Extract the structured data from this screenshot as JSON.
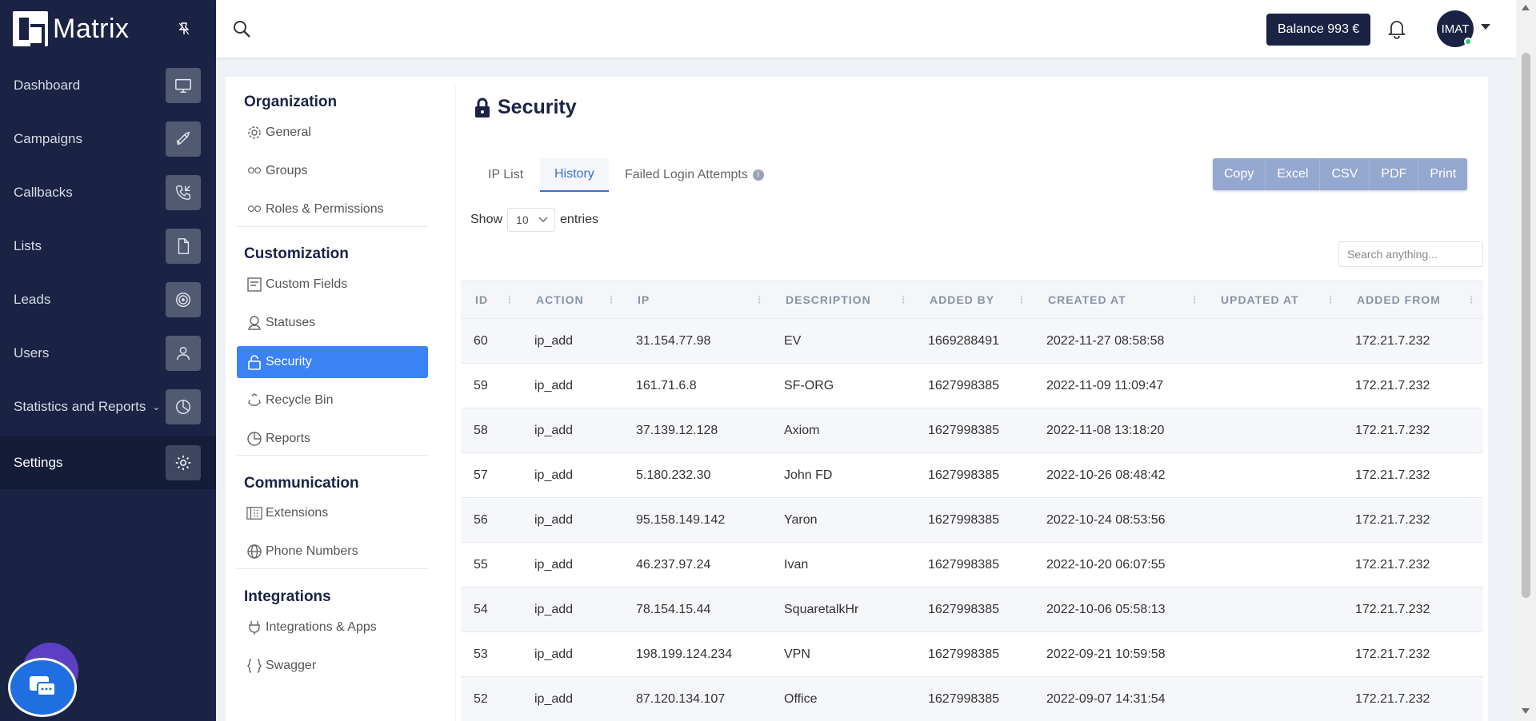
{
  "brand": {
    "name": "Matrix"
  },
  "nav": {
    "items": [
      {
        "label": "Dashboard"
      },
      {
        "label": "Campaigns"
      },
      {
        "label": "Callbacks"
      },
      {
        "label": "Lists"
      },
      {
        "label": "Leads"
      },
      {
        "label": "Users"
      },
      {
        "label": "Statistics and Reports"
      },
      {
        "label": "Settings"
      }
    ]
  },
  "topbar": {
    "balance": "Balance 993 €",
    "user_initials": "IMAT"
  },
  "submenu": {
    "sections": [
      {
        "title": "Organization",
        "items": [
          {
            "label": "General"
          },
          {
            "label": "Groups"
          },
          {
            "label": "Roles & Permissions"
          }
        ]
      },
      {
        "title": "Customization",
        "items": [
          {
            "label": "Custom Fields"
          },
          {
            "label": "Statuses"
          },
          {
            "label": "Security"
          },
          {
            "label": "Recycle Bin"
          },
          {
            "label": "Reports"
          }
        ]
      },
      {
        "title": "Communication",
        "items": [
          {
            "label": "Extensions"
          },
          {
            "label": "Phone Numbers"
          }
        ]
      },
      {
        "title": "Integrations",
        "items": [
          {
            "label": "Integrations & Apps"
          },
          {
            "label": "Swagger"
          }
        ]
      }
    ]
  },
  "page": {
    "title": "Security",
    "tabs": [
      {
        "label": "IP List"
      },
      {
        "label": "History"
      },
      {
        "label": "Failed Login Attempts"
      }
    ],
    "export_buttons": [
      {
        "label": "Copy"
      },
      {
        "label": "Excel"
      },
      {
        "label": "CSV"
      },
      {
        "label": "PDF"
      },
      {
        "label": "Print"
      }
    ],
    "show_label": "Show",
    "entries_value": "10",
    "entries_label": "entries",
    "search_placeholder": "Search anything..."
  },
  "table": {
    "columns": [
      "ID",
      "ACTION",
      "IP",
      "DESCRIPTION",
      "ADDED BY",
      "CREATED AT",
      "UPDATED AT",
      "ADDED FROM"
    ],
    "rows": [
      [
        "60",
        "ip_add",
        "31.154.77.98",
        "EV",
        "1669288491",
        "2022-11-27 08:58:58",
        "",
        "172.21.7.232"
      ],
      [
        "59",
        "ip_add",
        "161.71.6.8",
        "SF-ORG",
        "1627998385",
        "2022-11-09 11:09:47",
        "",
        "172.21.7.232"
      ],
      [
        "58",
        "ip_add",
        "37.139.12.128",
        "Axiom",
        "1627998385",
        "2022-11-08 13:18:20",
        "",
        "172.21.7.232"
      ],
      [
        "57",
        "ip_add",
        "5.180.232.30",
        "John FD",
        "1627998385",
        "2022-10-26 08:48:42",
        "",
        "172.21.7.232"
      ],
      [
        "56",
        "ip_add",
        "95.158.149.142",
        "Yaron",
        "1627998385",
        "2022-10-24 08:53:56",
        "",
        "172.21.7.232"
      ],
      [
        "55",
        "ip_add",
        "46.237.97.24",
        "Ivan",
        "1627998385",
        "2022-10-20 06:07:55",
        "",
        "172.21.7.232"
      ],
      [
        "54",
        "ip_add",
        "78.154.15.44",
        "SquaretalkHr",
        "1627998385",
        "2022-10-06 05:58:13",
        "",
        "172.21.7.232"
      ],
      [
        "53",
        "ip_add",
        "198.199.124.234",
        "VPN",
        "1627998385",
        "2022-09-21 10:59:58",
        "",
        "172.21.7.232"
      ],
      [
        "52",
        "ip_add",
        "87.120.134.107",
        "Office",
        "1627998385",
        "2022-09-07 14:31:54",
        "",
        "172.21.7.232"
      ]
    ]
  }
}
